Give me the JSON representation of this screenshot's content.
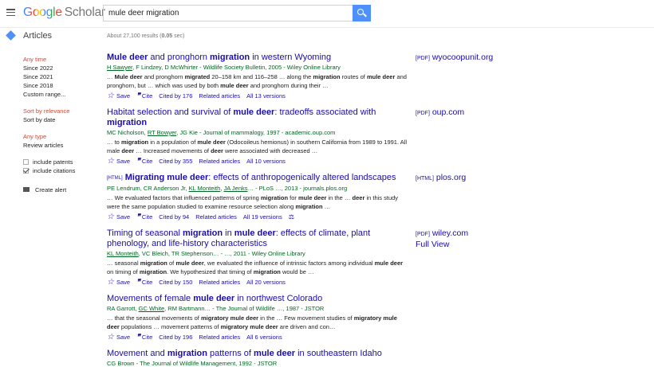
{
  "header": {
    "logo_google": "Google",
    "logo_scholar": "Scholar",
    "search_value": "mule deer migration"
  },
  "page": {
    "section_title": "Articles",
    "result_stats": "About 27,100 results (0.05 sec)"
  },
  "sidebar": {
    "time_filters": [
      "Any time",
      "Since 2022",
      "Since 2021",
      "Since 2018",
      "Custom range..."
    ],
    "sort_options": [
      "Sort by relevance",
      "Sort by date"
    ],
    "type_options": [
      "Any type",
      "Review articles"
    ],
    "include_patents_label": "include patents",
    "include_citations_label": "include citations",
    "include_patents_checked": false,
    "include_citations_checked": true,
    "create_alert_label": "Create alert"
  },
  "actions": {
    "save": "Save",
    "cite": "Cite",
    "related": "Related articles"
  },
  "results": [
    {
      "title_html": "<b>Mule deer</b> and pronghorn <b>migration</b> in western Wyoming",
      "authors_html": "<span class=\"auth-link\">H Sawyer</span>, F Lindzey, D McWhirter - Wildlife Society Bulletin, 2005 - Wiley Online Library",
      "snippet_html": "… <b>Mule deer</b> and pronghorn <b>migrated</b> 20–158 km and 116–258 … along the <b>migration</b> routes of <b>mule deer</b> and pronghorn, but … which was used by both <b>mule deer</b> and pronghorn during their …",
      "cited_by": "Cited by 176",
      "versions": "All 13 versions",
      "link": {
        "tag": "[PDF]",
        "domain": "wyocoopunit.org"
      }
    },
    {
      "title_html": "Habitat selection and survival of <b>mule deer</b>: tradeoffs associated with <b>migration</b>",
      "authors_html": "MC Nicholson, <span class=\"auth-link\">RT Bowyer</span>, JG Kie - Journal of mammalogy, 1997 - academic.oup.com",
      "snippet_html": "… to <b>migration</b> in a population of <b>mule deer</b> (Odocoileus hemionus) in southern California from 1989 to 1991. All male <b>deer</b> … Increased movements of <b>deer</b> were associated with decreased …",
      "cited_by": "Cited by 355",
      "versions": "All 10 versions",
      "link": {
        "tag": "[PDF]",
        "domain": "oup.com"
      }
    },
    {
      "title_html": "<span class=\"html-tag\">[HTML]</span> <b>Migrating mule deer</b>: effects of anthropogenically altered landscapes",
      "authors_html": "PE Lendrum, CR Anderson Jr, <span class=\"auth-link\">KL Monteith</span>, <span class=\"auth-link\">JA Jenks</span>… - PLoS …, 2013 - journals.plos.org",
      "snippet_html": "… We evaluated factors that influenced patterns of spring <b>migration</b> for <b>mule deer</b> in the … <b>deer</b> in this study were the same population studied to examine resource selection along <b>migration</b> …",
      "cited_by": "Cited by 94",
      "versions": "All 19 versions",
      "link": {
        "tag": "[HTML]",
        "domain": "plos.org"
      }
    },
    {
      "title_html": "Timing of seasonal <b>migration</b> in <b>mule deer</b>: effects of climate, plant phenology, and life-history characteristics",
      "authors_html": "<span class=\"auth-link\">KL Monteith</span>, VC Bleich, TR Stephenson… - …, 2011 - Wiley Online Library",
      "snippet_html": "… seasonal <b>migration</b> of <b>mule deer</b>, we evaluated the influence of intrinsic factors among individual <b>mule deer</b> on timing of <b>migration</b>. We hypothesized that timing of <b>migration</b> would be …",
      "cited_by": "Cited by 150",
      "versions": "All 20 versions",
      "link": {
        "tag": "[PDF]",
        "domain": "wiley.com",
        "extra": "Full View"
      }
    },
    {
      "title_html": "Movements of female <b>mule deer</b> in northwest Colorado",
      "authors_html": "RA Garrott, <span class=\"auth-link\">GC White</span>, RM Bartmann… - The Journal of Wildlife …, 1987 - JSTOR",
      "snippet_html": "… that the seasonal movements of <b>migratory mule deer</b> in the … Few movement studies of <b>migratory mule deer</b> populations … movement patterns of <b>migratory mule deer</b> are driven and con…",
      "cited_by": "Cited by 196",
      "versions": "All 6 versions",
      "link": null
    },
    {
      "title_html": "Movement and <b>migration</b> patterns of <b>mule deer</b> in southeastern Idaho",
      "authors_html": "CG Brown - The Journal of Wildlife Management, 1992 - JSTOR",
      "snippet_html": "",
      "cited_by": "",
      "versions": "",
      "link": null
    }
  ]
}
